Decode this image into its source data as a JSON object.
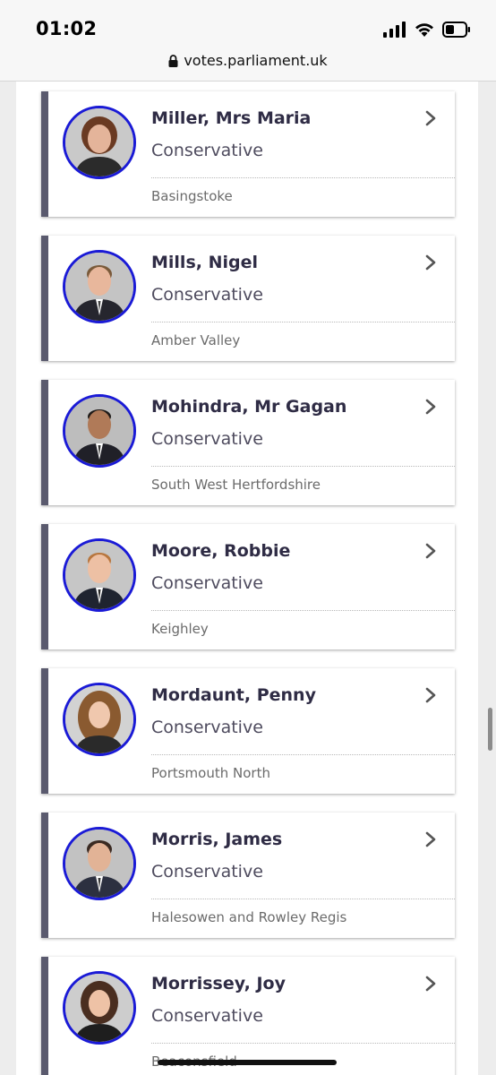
{
  "status_bar": {
    "time": "01:02"
  },
  "browser": {
    "url": "votes.parliament.uk"
  },
  "members": [
    {
      "name": "Miller, Mrs Maria",
      "party": "Conservative",
      "constituency": "Basingstoke"
    },
    {
      "name": "Mills, Nigel",
      "party": "Conservative",
      "constituency": "Amber Valley"
    },
    {
      "name": "Mohindra, Mr Gagan",
      "party": "Conservative",
      "constituency": "South West Hertfordshire"
    },
    {
      "name": "Moore, Robbie",
      "party": "Conservative",
      "constituency": "Keighley"
    },
    {
      "name": "Mordaunt, Penny",
      "party": "Conservative",
      "constituency": "Portsmouth North"
    },
    {
      "name": "Morris, James",
      "party": "Conservative",
      "constituency": "Halesowen and Rowley Regis"
    },
    {
      "name": "Morrissey, Joy",
      "party": "Conservative",
      "constituency": "Beaconsfield"
    }
  ],
  "colors": {
    "party_accent": "#5a5a6e",
    "avatar_ring": "#1a1ad6",
    "name_text": "#2f2c45"
  },
  "icons": {
    "row_action": "chevron-right-icon",
    "lock": "lock-icon"
  }
}
